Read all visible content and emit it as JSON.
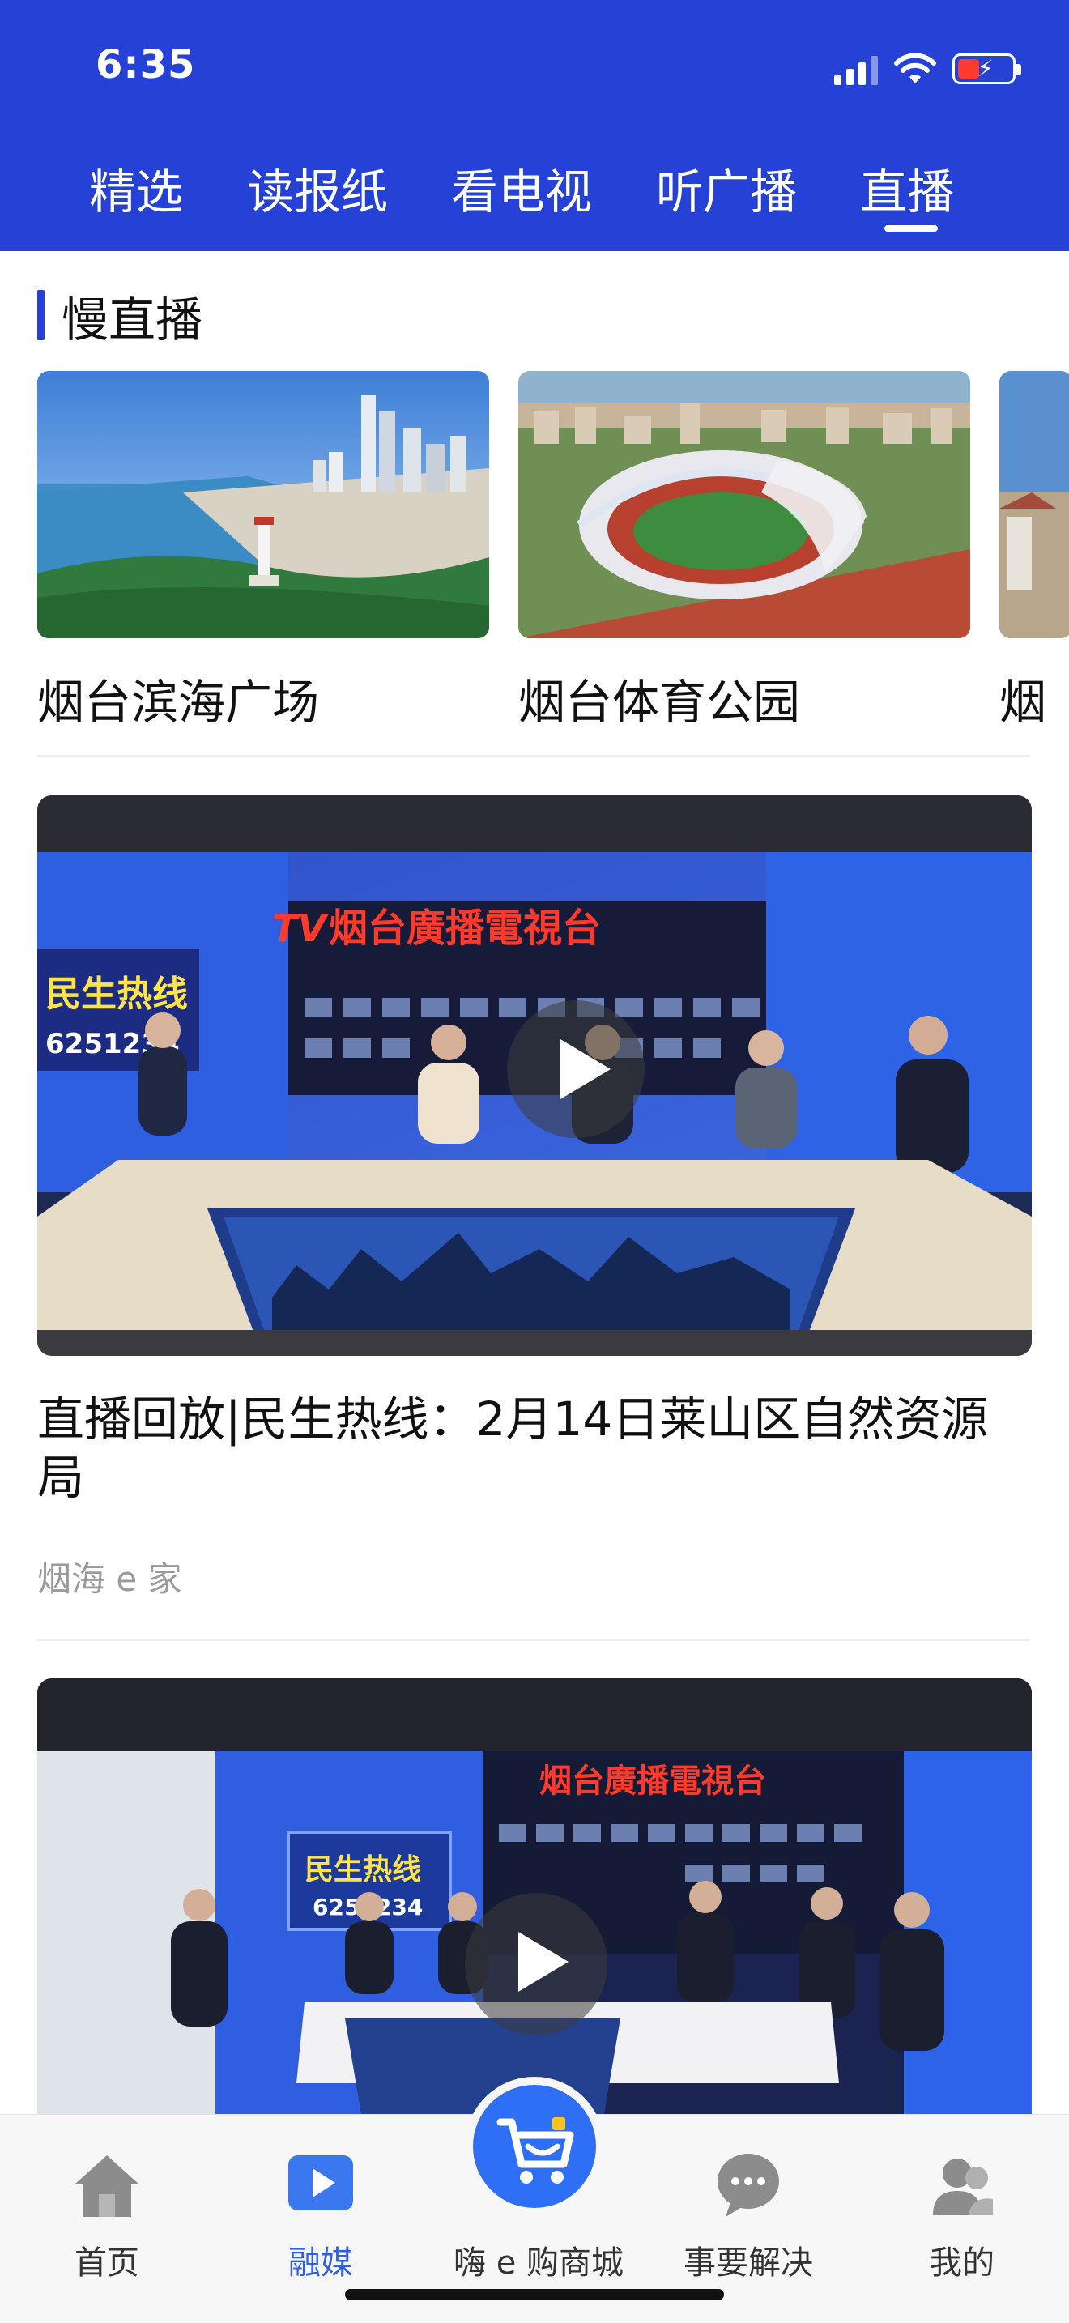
{
  "status_bar": {
    "time": "6:35"
  },
  "top_tabs": [
    {
      "label": "精选",
      "active": false
    },
    {
      "label": "读报纸",
      "active": false
    },
    {
      "label": "看电视",
      "active": false
    },
    {
      "label": "听广播",
      "active": false
    },
    {
      "label": "直播",
      "active": true
    }
  ],
  "section": {
    "title": "慢直播"
  },
  "slow_live": [
    {
      "caption": "烟台滨海广场"
    },
    {
      "caption": "烟台体育公园"
    },
    {
      "caption": "烟"
    }
  ],
  "videos": [
    {
      "title": "直播回放|民生热线：2月14日莱山区自然资源局",
      "source": "烟海 e 家",
      "studio_logo": "烟台廣播電視台",
      "screen_text": "民生热线",
      "screen_number": "6251234"
    },
    {
      "studio_logo": "烟台廣播電視台",
      "screen_text": "民生热线",
      "screen_number": "6251234"
    }
  ],
  "bottom_tabs": [
    {
      "label": "首页",
      "icon": "home-icon",
      "active": false
    },
    {
      "label": "融媒",
      "icon": "play-icon",
      "active": true
    },
    {
      "label": "嗨 e 购商城",
      "icon": "cart-icon",
      "active": false
    },
    {
      "label": "事要解决",
      "icon": "chat-icon",
      "active": false
    },
    {
      "label": "我的",
      "icon": "user-icon",
      "active": false
    }
  ],
  "colors": {
    "brand_blue": "#2541d6",
    "active_tab": "#2f5fe0",
    "inactive_tab": "#333333"
  }
}
